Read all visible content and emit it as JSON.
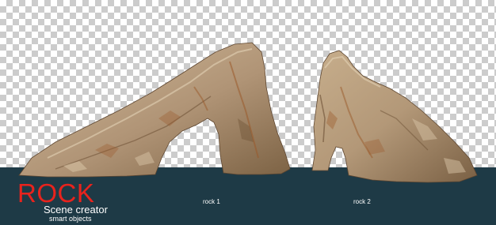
{
  "brand": {
    "title": "ROCK",
    "subtitle": "Scene creator",
    "tagline": "smart objects"
  },
  "rocks": [
    {
      "label": "rock 1"
    },
    {
      "label": "rock 2"
    }
  ],
  "colors": {
    "ground": "#1e3a46",
    "title": "#e8231d",
    "rock_base": "#b79c7c",
    "rock_shadow": "#6e5538",
    "rock_highlight": "#d8c4a6",
    "rust": "#9a5a2a"
  }
}
